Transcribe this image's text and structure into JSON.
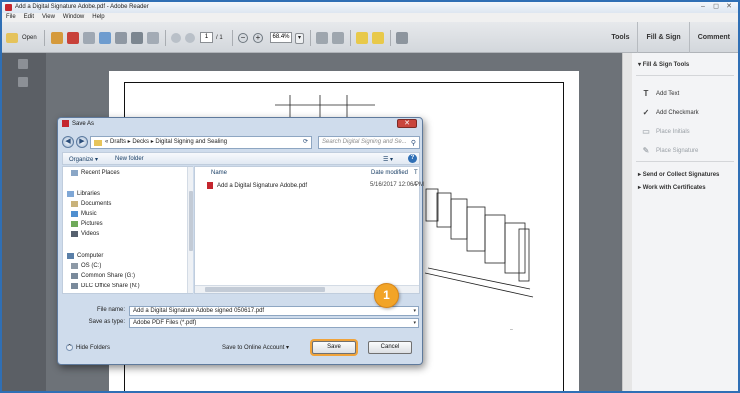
{
  "window": {
    "title": "Add a Digital Signature Adobe.pdf - Adobe Reader",
    "min_glyph": "–",
    "max_glyph": "◻",
    "close_glyph": "✕"
  },
  "menu": [
    "File",
    "Edit",
    "View",
    "Window",
    "Help"
  ],
  "toolbar": {
    "open_label": "Open",
    "page_current": "1",
    "page_total": "/ 1",
    "zoom": "68.4%",
    "zoom_out_glyph": "−",
    "zoom_in_glyph": "+",
    "zoom_dropdown_glyph": "▾",
    "tabs": [
      "Tools",
      "Fill & Sign",
      "Comment"
    ]
  },
  "right_pane": {
    "header": "Fill & Sign Tools",
    "items": [
      {
        "icon": "T",
        "label": "Add Text",
        "enabled": true
      },
      {
        "icon": "✓",
        "label": "Add Checkmark",
        "enabled": true
      },
      {
        "icon": "▭",
        "label": "Place Initials",
        "enabled": false
      },
      {
        "icon": "✎",
        "label": "Place Signature",
        "enabled": false
      }
    ],
    "groups": [
      "Send or Collect Signatures",
      "Work with Certificates"
    ]
  },
  "dialog": {
    "title": "Save As",
    "back_glyph": "◀",
    "forward_glyph": "▶",
    "breadcrumb": "« Drafts ▸ Decks ▸ Digital Signing and Sealing",
    "refresh_glyph": "⟳",
    "search_placeholder": "Search Digital Signing and Se...",
    "organize_label": "Organize ▾",
    "new_folder_label": "New folder",
    "view_glyph": "☰ ▾",
    "help_glyph": "?",
    "nav_items": [
      {
        "label": "Recent Places",
        "color": "#8aa6c6"
      },
      {
        "label": "Libraries",
        "color": "#7fa7d6"
      },
      {
        "label": "Documents",
        "color": "#c9b27a"
      },
      {
        "label": "Music",
        "color": "#4f8fd0"
      },
      {
        "label": "Pictures",
        "color": "#6faa5a"
      },
      {
        "label": "Videos",
        "color": "#56606e"
      },
      {
        "label": "Computer",
        "color": "#5a7fa8"
      },
      {
        "label": "OS (C:)",
        "color": "#8d99a6"
      },
      {
        "label": "Common Share (G:)",
        "color": "#7a8a9b"
      },
      {
        "label": "DLC Office Share (N:)",
        "color": "#7a8a9b"
      }
    ],
    "columns": [
      "Name",
      "Date modified",
      "T"
    ],
    "files": [
      {
        "name": "Add a Digital Signature Adobe.pdf",
        "date": "5/16/2017 12:06 PM",
        "type": "A"
      }
    ],
    "file_name_label": "File name:",
    "file_name_value": "Add a Digital Signature Adobe signed 050617.pdf",
    "save_type_label": "Save as type:",
    "save_type_value": "Adobe PDF Files (*.pdf)",
    "hide_folders_label": "Hide Folders",
    "save_online_label": "Save to Online Account",
    "save_label": "Save",
    "cancel_label": "Cancel"
  },
  "callout": "1",
  "colors": {
    "frame_blue": "#2f6fb5",
    "callout_orange": "#f2a427",
    "doc_background": "#6d7278",
    "nav_strip": "#5b5f65"
  }
}
